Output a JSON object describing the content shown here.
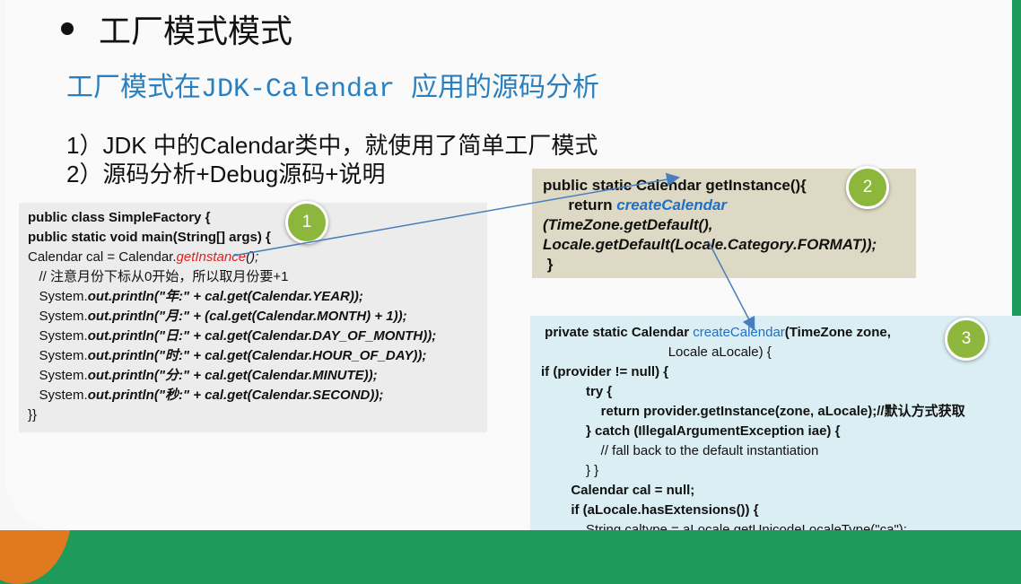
{
  "title": "工厂模式模式",
  "subtitle": "工厂模式在JDK-Calendar 应用的源码分析",
  "points": [
    "1）JDK 中的Calendar类中，就使用了简单工厂模式",
    "2）源码分析+Debug源码+说明"
  ],
  "badges": [
    "1",
    "2",
    "3"
  ],
  "box1": {
    "l1": "public class SimpleFactory {",
    "l2": "public static void main(String[] args) {",
    "l3a": "Calendar cal = Calendar.",
    "l3b": "getInstance",
    "l3c": "();",
    "l4": "   // 注意月份下标从0开始，所以取月份要+1",
    "l5a": "   System.",
    "l5b": "out.println(\"年:\" + cal.get(Calendar.YEAR));",
    "l6b": "out.println(\"月:\" + (cal.get(Calendar.MONTH) + 1));",
    "l7b": "out.println(\"日:\" + cal.get(Calendar.DAY_OF_MONTH));",
    "l8b": "out.println(\"时:\" + cal.get(Calendar.HOUR_OF_DAY));",
    "l9b": "out.println(\"分:\" + cal.get(Calendar.MINUTE));",
    "l10b": "out.println(\"秒:\" + cal.get(Calendar.SECOND));",
    "l11": "}}"
  },
  "box2": {
    "l1": "public static Calendar getInstance(){",
    "l2a": "      return ",
    "l2b": "createCalendar",
    "l3": "(TimeZone.getDefault(),",
    "l4": "Locale.getDefault(Locale.Category.FORMAT));",
    "l5": " }"
  },
  "box3": {
    "l1a": " private static Calendar ",
    "l1b": "createCalendar",
    "l1c": "(TimeZone zone,",
    "l2": "                                  Locale aLocale) {",
    "l3": "if (provider != null) {",
    "l4": "            try {",
    "l5": "                return provider.getInstance(zone, aLocale);//默认方式获取",
    "l6": "            } catch (IllegalArgumentException iae) {",
    "l7": "                // fall back to the default instantiation",
    "l8": "            } }",
    "l9": "        Calendar cal = null;",
    "l10": "        if (aLocale.hasExtensions()) {",
    "l11": "            String caltype = aLocale.getUnicodeLocaleType(\"ca\");"
  }
}
